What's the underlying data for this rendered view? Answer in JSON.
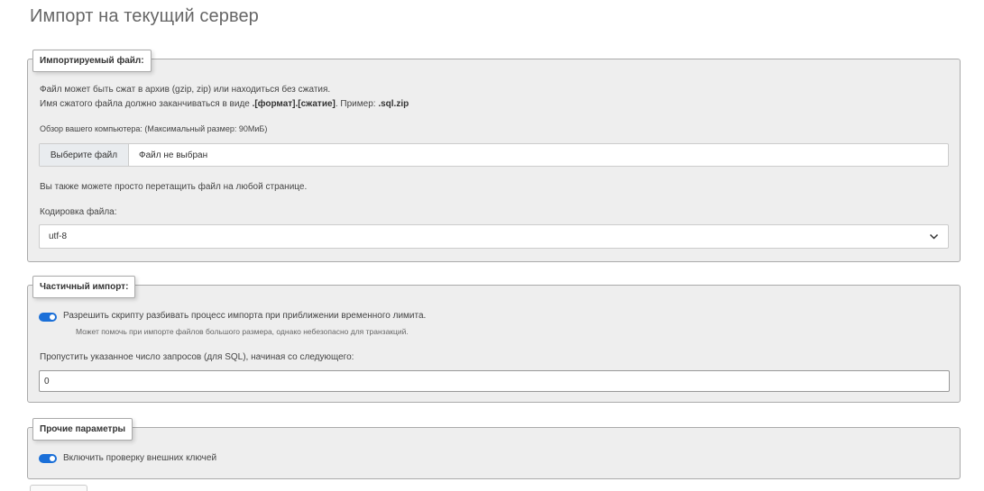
{
  "page_title": "Импорт на текущий сервер",
  "file_section": {
    "legend": "Импортируемый файл:",
    "line1": "Файл может быть сжат в архив (gzip, zip) или находиться без сжатия.",
    "line2_prefix": "Имя сжатого файла должно заканчиваться в виде ",
    "line2_format": ".[формат].[сжатие]",
    "line2_middle": ". Пример: ",
    "line2_example": ".sql.zip",
    "browse_label": "Обзор вашего компьютера: (Максимальный размер: 90МиБ)",
    "choose_button": "Выберите файл",
    "no_file": "Файл не выбран",
    "drag_hint": "Вы также можете просто перетащить файл на любой странице.",
    "charset_label": "Кодировка файла:",
    "charset_value": "utf-8"
  },
  "partial_section": {
    "legend": "Частичный импорт:",
    "allow_interrupt_label": "Разрешить скрипту разбивать процесс импорта при приближении временного лимита.",
    "allow_interrupt_enabled": true,
    "allow_interrupt_hint": "Может помочь при импорте файлов большого размера, однако небезопасно для транзакций.",
    "skip_label": "Пропустить указанное число запросов (для SQL), начиная со следующего:",
    "skip_value": "0"
  },
  "other_section": {
    "legend": "Прочие параметры",
    "fk_checks_label": "Включить проверку внешних ключей",
    "fk_checks_enabled": true
  },
  "colors": {
    "toggle_on": "#1a6fd8",
    "fieldset_bg": "#eeeeee"
  }
}
